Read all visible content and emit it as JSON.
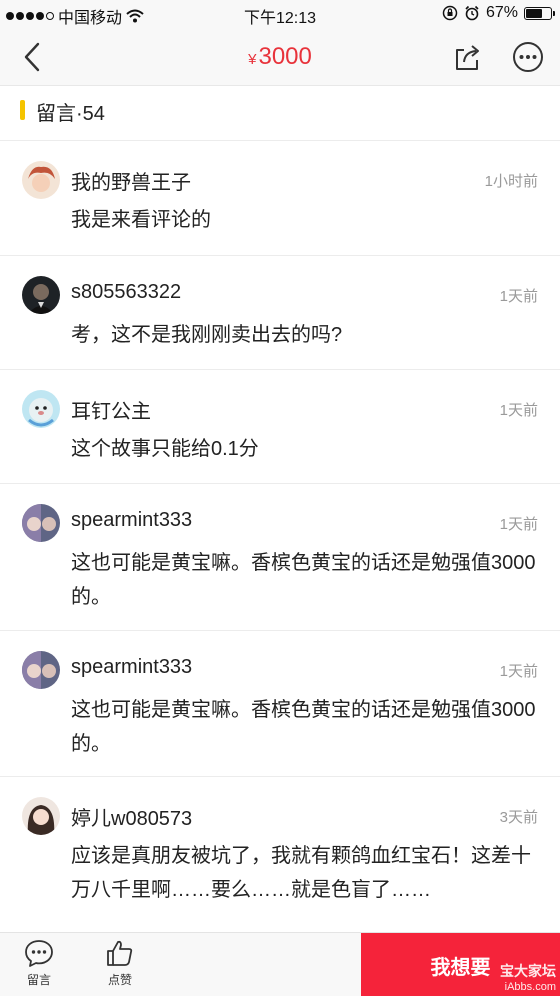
{
  "status_bar": {
    "carrier": "中国移动",
    "time": "下午12:13",
    "battery": "67%",
    "battery_level": 0.67
  },
  "nav": {
    "currency": "¥",
    "price": "3000"
  },
  "section": {
    "title": "留言·54"
  },
  "comments": [
    {
      "user": "我的野兽王子",
      "time": "1小时前",
      "text": "我是来看评论的",
      "avatar_color": "#c87a5a"
    },
    {
      "user": "s805563322",
      "time": "1天前",
      "text": "考，这不是我刚刚卖出去的吗?",
      "avatar_color": "#2a2e33"
    },
    {
      "user": "耳钉公主",
      "time": "1天前",
      "text": "这个故事只能给0.1分",
      "avatar_color": "#8fd0e8"
    },
    {
      "user": "spearmint333",
      "time": "1天前",
      "text": "这也可能是黄宝嘛。香槟色黄宝的话还是勉强值3000的。",
      "avatar_color": "#6a6f8e"
    },
    {
      "user": "spearmint333",
      "time": "1天前",
      "text": "这也可能是黄宝嘛。香槟色黄宝的话还是勉强值3000的。",
      "avatar_color": "#6a6f8e"
    },
    {
      "user": "婷儿w080573",
      "time": "3天前",
      "text": "应该是真朋友被坑了，我就有颗鸽血红宝石！这差十万八千里啊……要么……就是色盲了……",
      "avatar_color": "#d8b8a8"
    }
  ],
  "bottom_bar": {
    "comment_label": "留言",
    "like_label": "点赞",
    "want_label": "我想要",
    "watermark": "宝大家坛",
    "watermark_sub": "iAbbs.com"
  },
  "colors": {
    "accent_red": "#e8333b",
    "want_button": "#f5233a",
    "section_marker": "#f5c400"
  }
}
